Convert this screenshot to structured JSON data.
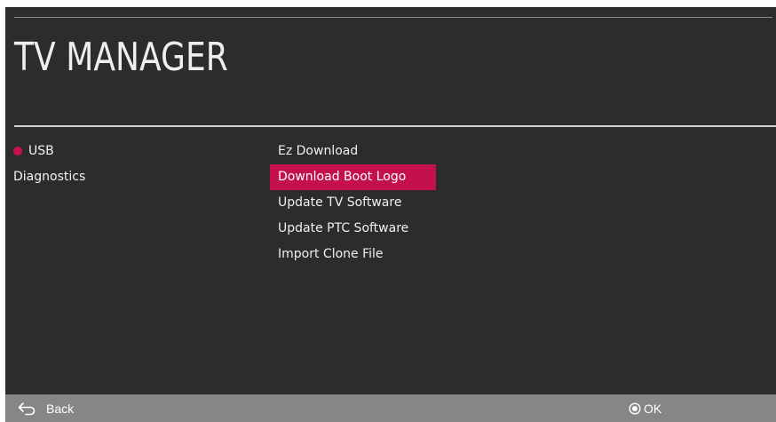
{
  "header": {
    "title": "TV MANAGER"
  },
  "left_menu": {
    "items": [
      {
        "label": "USB",
        "selected": true,
        "marker_color": "#c9114f"
      },
      {
        "label": "Diagnostics",
        "selected": false
      }
    ]
  },
  "right_menu": {
    "items": [
      {
        "label": "Ez Download",
        "selected": false
      },
      {
        "label": "Download Boot Logo",
        "selected": true
      },
      {
        "label": "Update TV Software",
        "selected": false
      },
      {
        "label": "Update PTC Software",
        "selected": false
      },
      {
        "label": "Import Clone File",
        "selected": false
      }
    ],
    "highlight_color": "#c5104f"
  },
  "footer": {
    "back_label": "Back",
    "back_icon": "back-arrow-icon",
    "ok_label": "OK",
    "ok_icon": "ok-circle-icon"
  },
  "colors": {
    "background": "#2d2c2c",
    "accent": "#c5104f",
    "footer": "#868686"
  }
}
